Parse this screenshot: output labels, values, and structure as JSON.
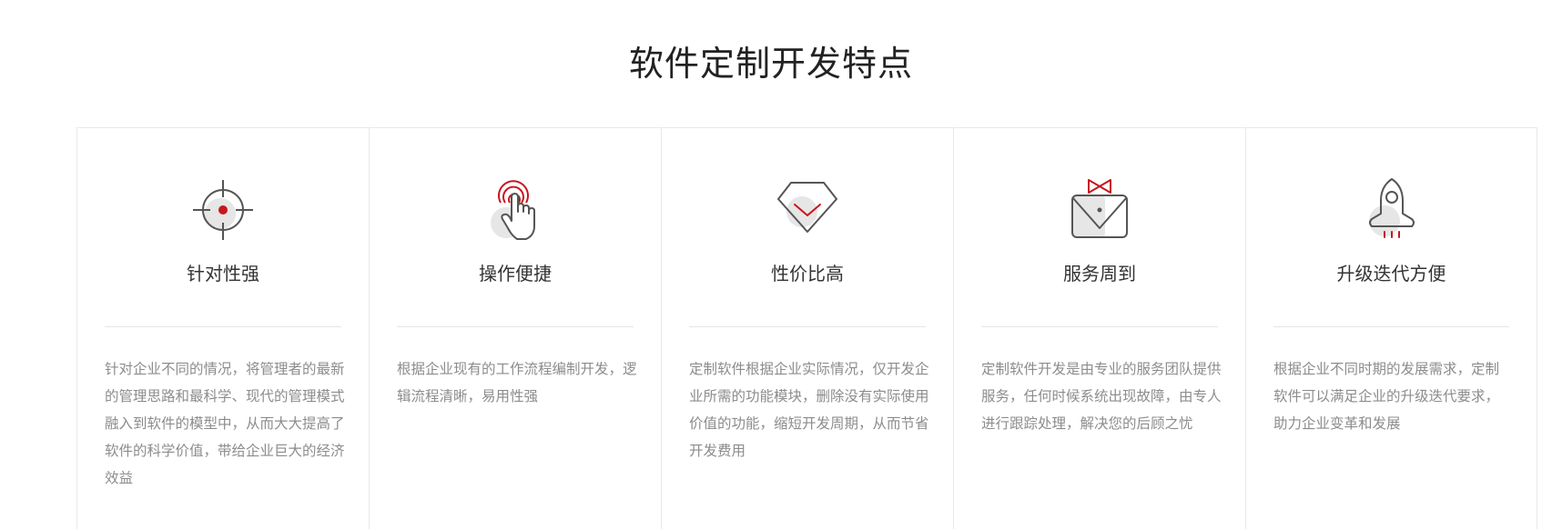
{
  "section": {
    "title": "软件定制开发特点"
  },
  "colors": {
    "accent": "#c8161d",
    "icon_stroke": "#555555",
    "icon_fill": "#e6e6e6",
    "text_muted": "#8c8c8c"
  },
  "cards": [
    {
      "icon": "crosshair-icon",
      "title": "针对性强",
      "description": "针对企业不同的情况，将管理者的最新的管理思路和最科学、现代的管理模式融入到软件的模型中，从而大大提高了软件的科学价值，带给企业巨大的经济效益"
    },
    {
      "icon": "touch-hand-icon",
      "title": "操作便捷",
      "description": "根据企业现有的工作流程编制开发，逻辑流程清晰，易用性强"
    },
    {
      "icon": "diamond-icon",
      "title": "性价比高",
      "description": "定制软件根据企业实际情况，仅开发企业所需的功能模块，删除没有实际使用价值的功能，缩短开发周期，从而节省开发费用"
    },
    {
      "icon": "bowtie-suit-icon",
      "title": "服务周到",
      "description": "定制软件开发是由专业的服务团队提供服务，任何时候系统出现故障，由专人进行跟踪处理，解决您的后顾之忧"
    },
    {
      "icon": "rocket-icon",
      "title": "升级迭代方便",
      "description": "根据企业不同时期的发展需求，定制软件可以满足企业的升级迭代要求，助力企业变革和发展"
    }
  ]
}
